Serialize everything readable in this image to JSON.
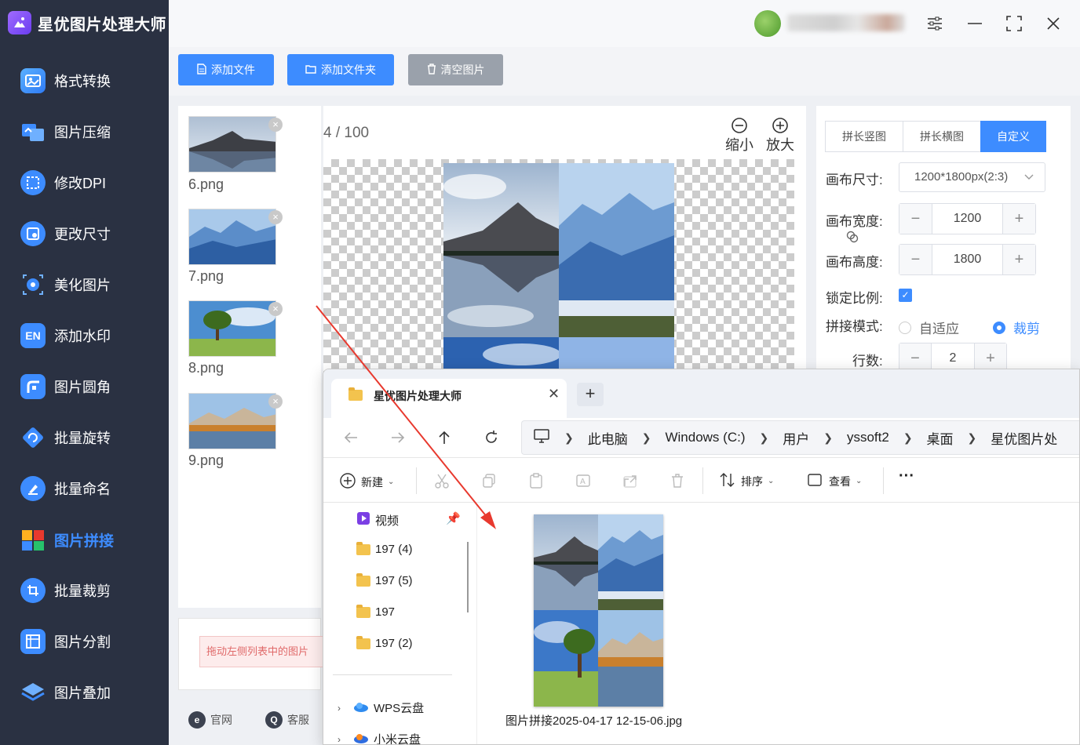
{
  "app": {
    "title": "星优图片处理大师",
    "user_name_redacted": ""
  },
  "sidebar": {
    "items": [
      {
        "label": "格式转换",
        "icon": "image-convert-icon",
        "color": "#3d8cff"
      },
      {
        "label": "图片压缩",
        "icon": "image-compress-icon",
        "color": "#3d8cff"
      },
      {
        "label": "修改DPI",
        "icon": "dpi-icon",
        "color": "#3d8cff"
      },
      {
        "label": "更改尺寸",
        "icon": "resize-icon",
        "color": "#3d8cff"
      },
      {
        "label": "美化图片",
        "icon": "beautify-icon",
        "color": "#3d8cff"
      },
      {
        "label": "添加水印",
        "icon": "watermark-icon",
        "color": "#3d8cff"
      },
      {
        "label": "图片圆角",
        "icon": "round-corner-icon",
        "color": "#3d8cff"
      },
      {
        "label": "批量旋转",
        "icon": "rotate-icon",
        "color": "#3d8cff"
      },
      {
        "label": "批量命名",
        "icon": "rename-icon",
        "color": "#3d8cff"
      },
      {
        "label": "图片拼接",
        "icon": "puzzle-icon",
        "color": "#3d8cff",
        "active": true
      },
      {
        "label": "批量裁剪",
        "icon": "crop-icon",
        "color": "#3d8cff"
      },
      {
        "label": "图片分割",
        "icon": "split-icon",
        "color": "#3d8cff"
      },
      {
        "label": "图片叠加",
        "icon": "layers-icon",
        "color": "#3d8cff"
      }
    ]
  },
  "toolbar": {
    "add_file": "添加文件",
    "add_folder": "添加文件夹",
    "clear": "清空图片"
  },
  "thumbnails": [
    {
      "name": "6.png"
    },
    {
      "name": "7.png"
    },
    {
      "name": "8.png"
    },
    {
      "name": "9.png"
    }
  ],
  "hint": "拖动左侧列表中的图片",
  "footer": {
    "website": "官网",
    "support": "客服"
  },
  "preview": {
    "page_current": "4",
    "page_total": "/ 100",
    "zoom_out": "缩小",
    "zoom_in": "放大"
  },
  "settings": {
    "tabs": [
      "拼长竖图",
      "拼长横图",
      "自定义"
    ],
    "active_tab": 2,
    "canvas_size_label": "画布尺寸:",
    "canvas_size_value": "1200*1800px(2:3)",
    "canvas_width_label": "画布宽度:",
    "canvas_width": "1200",
    "canvas_height_label": "画布高度:",
    "canvas_height": "1800",
    "lock_ratio_label": "锁定比例:",
    "lock_ratio": true,
    "mode_label": "拼接模式:",
    "mode_fit": "自适应",
    "mode_crop": "裁剪",
    "mode_selected": "裁剪",
    "rows_label": "行数:",
    "rows": "2"
  },
  "explorer": {
    "tab_title": "星优图片处理大师",
    "breadcrumbs": [
      "此电脑",
      "Windows (C:)",
      "用户",
      "yssoft2",
      "桌面",
      "星优图片处"
    ],
    "cmd": {
      "new": "新建",
      "sort": "排序",
      "view": "查看"
    },
    "tree": [
      {
        "label": "视频",
        "type": "video"
      },
      {
        "label": "197 (4)",
        "type": "folder"
      },
      {
        "label": "197 (5)",
        "type": "folder"
      },
      {
        "label": "197",
        "type": "folder"
      },
      {
        "label": "197 (2)",
        "type": "folder"
      },
      {
        "label": "WPS云盘",
        "type": "cloud"
      },
      {
        "label": "小米云盘",
        "type": "cloud"
      }
    ],
    "file_name": "图片拼接2025-04-17 12-15-06.jpg"
  },
  "colors": {
    "accent": "#3d8cff",
    "sidebar_bg": "#2a3142",
    "arrow": "#e8392e"
  }
}
